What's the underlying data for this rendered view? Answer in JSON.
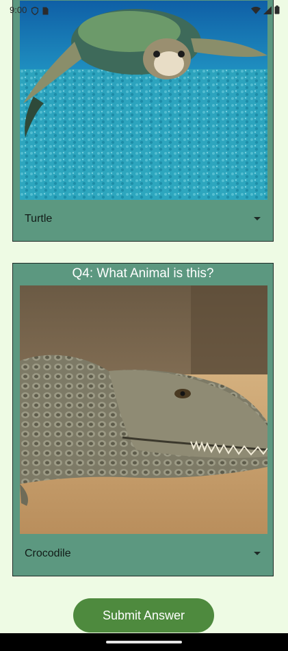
{
  "status_bar": {
    "time": "9:00",
    "left_icons": [
      "shield-icon",
      "sim-card-icon"
    ],
    "right_icons": [
      "wifi-icon",
      "signal-icon",
      "battery-icon"
    ]
  },
  "questions": [
    {
      "image": "turtle-photo",
      "selected_answer": "Turtle"
    },
    {
      "title": "Q4: What Animal is this?",
      "image": "crocodile-photo",
      "selected_answer": "Crocodile"
    }
  ],
  "submit": {
    "label": "Submit Answer"
  },
  "colors": {
    "background": "#eefbe4",
    "card": "#5c9880",
    "button": "#4e8a3e"
  }
}
